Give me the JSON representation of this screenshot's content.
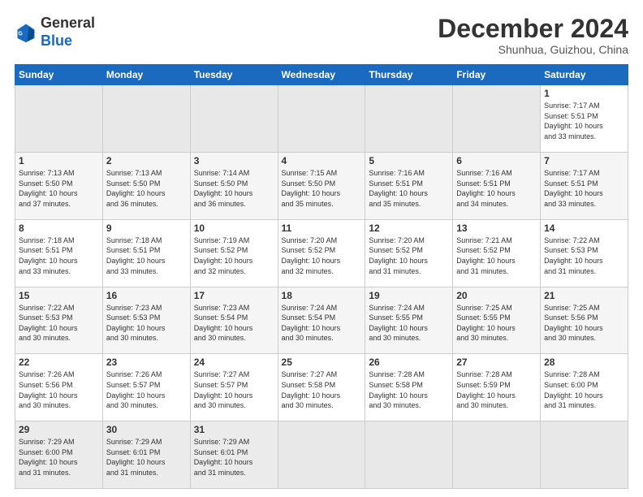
{
  "header": {
    "logo_general": "General",
    "logo_blue": "Blue",
    "month_title": "December 2024",
    "location": "Shunhua, Guizhou, China"
  },
  "calendar": {
    "days_of_week": [
      "Sunday",
      "Monday",
      "Tuesday",
      "Wednesday",
      "Thursday",
      "Friday",
      "Saturday"
    ],
    "weeks": [
      [
        null,
        null,
        null,
        null,
        null,
        null,
        {
          "day": 1,
          "sunrise": "7:17 AM",
          "sunset": "5:51 PM",
          "daylight": "10 hours and 33 minutes."
        }
      ],
      [
        {
          "day": 1,
          "sunrise": "7:13 AM",
          "sunset": "5:50 PM",
          "daylight": "10 hours and 37 minutes."
        },
        {
          "day": 2,
          "sunrise": "7:13 AM",
          "sunset": "5:50 PM",
          "daylight": "10 hours and 36 minutes."
        },
        {
          "day": 3,
          "sunrise": "7:14 AM",
          "sunset": "5:50 PM",
          "daylight": "10 hours and 36 minutes."
        },
        {
          "day": 4,
          "sunrise": "7:15 AM",
          "sunset": "5:50 PM",
          "daylight": "10 hours and 35 minutes."
        },
        {
          "day": 5,
          "sunrise": "7:16 AM",
          "sunset": "5:51 PM",
          "daylight": "10 hours and 35 minutes."
        },
        {
          "day": 6,
          "sunrise": "7:16 AM",
          "sunset": "5:51 PM",
          "daylight": "10 hours and 34 minutes."
        },
        {
          "day": 7,
          "sunrise": "7:17 AM",
          "sunset": "5:51 PM",
          "daylight": "10 hours and 33 minutes."
        }
      ],
      [
        {
          "day": 8,
          "sunrise": "7:18 AM",
          "sunset": "5:51 PM",
          "daylight": "10 hours and 33 minutes."
        },
        {
          "day": 9,
          "sunrise": "7:18 AM",
          "sunset": "5:51 PM",
          "daylight": "10 hours and 33 minutes."
        },
        {
          "day": 10,
          "sunrise": "7:19 AM",
          "sunset": "5:52 PM",
          "daylight": "10 hours and 32 minutes."
        },
        {
          "day": 11,
          "sunrise": "7:20 AM",
          "sunset": "5:52 PM",
          "daylight": "10 hours and 32 minutes."
        },
        {
          "day": 12,
          "sunrise": "7:20 AM",
          "sunset": "5:52 PM",
          "daylight": "10 hours and 31 minutes."
        },
        {
          "day": 13,
          "sunrise": "7:21 AM",
          "sunset": "5:52 PM",
          "daylight": "10 hours and 31 minutes."
        },
        {
          "day": 14,
          "sunrise": "7:22 AM",
          "sunset": "5:53 PM",
          "daylight": "10 hours and 31 minutes."
        }
      ],
      [
        {
          "day": 15,
          "sunrise": "7:22 AM",
          "sunset": "5:53 PM",
          "daylight": "10 hours and 30 minutes."
        },
        {
          "day": 16,
          "sunrise": "7:23 AM",
          "sunset": "5:53 PM",
          "daylight": "10 hours and 30 minutes."
        },
        {
          "day": 17,
          "sunrise": "7:23 AM",
          "sunset": "5:54 PM",
          "daylight": "10 hours and 30 minutes."
        },
        {
          "day": 18,
          "sunrise": "7:24 AM",
          "sunset": "5:54 PM",
          "daylight": "10 hours and 30 minutes."
        },
        {
          "day": 19,
          "sunrise": "7:24 AM",
          "sunset": "5:55 PM",
          "daylight": "10 hours and 30 minutes."
        },
        {
          "day": 20,
          "sunrise": "7:25 AM",
          "sunset": "5:55 PM",
          "daylight": "10 hours and 30 minutes."
        },
        {
          "day": 21,
          "sunrise": "7:25 AM",
          "sunset": "5:56 PM",
          "daylight": "10 hours and 30 minutes."
        }
      ],
      [
        {
          "day": 22,
          "sunrise": "7:26 AM",
          "sunset": "5:56 PM",
          "daylight": "10 hours and 30 minutes."
        },
        {
          "day": 23,
          "sunrise": "7:26 AM",
          "sunset": "5:57 PM",
          "daylight": "10 hours and 30 minutes."
        },
        {
          "day": 24,
          "sunrise": "7:27 AM",
          "sunset": "5:57 PM",
          "daylight": "10 hours and 30 minutes."
        },
        {
          "day": 25,
          "sunrise": "7:27 AM",
          "sunset": "5:58 PM",
          "daylight": "10 hours and 30 minutes."
        },
        {
          "day": 26,
          "sunrise": "7:28 AM",
          "sunset": "5:58 PM",
          "daylight": "10 hours and 30 minutes."
        },
        {
          "day": 27,
          "sunrise": "7:28 AM",
          "sunset": "5:59 PM",
          "daylight": "10 hours and 30 minutes."
        },
        {
          "day": 28,
          "sunrise": "7:28 AM",
          "sunset": "6:00 PM",
          "daylight": "10 hours and 31 minutes."
        }
      ],
      [
        {
          "day": 29,
          "sunrise": "7:29 AM",
          "sunset": "6:00 PM",
          "daylight": "10 hours and 31 minutes."
        },
        {
          "day": 30,
          "sunrise": "7:29 AM",
          "sunset": "6:01 PM",
          "daylight": "10 hours and 31 minutes."
        },
        {
          "day": 31,
          "sunrise": "7:29 AM",
          "sunset": "6:01 PM",
          "daylight": "10 hours and 31 minutes."
        },
        null,
        null,
        null,
        null
      ]
    ]
  }
}
